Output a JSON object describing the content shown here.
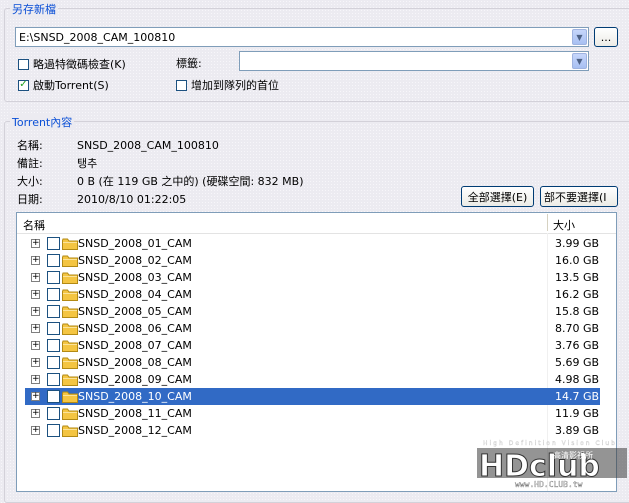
{
  "save_section": {
    "title": "另存新檔",
    "path_value": "E:\\SNSD_2008_CAM_100810",
    "browse_label": "...",
    "skip_hash_label": "略過特徵碼檢查(K)",
    "skip_hash_checked": false,
    "start_torrent_label": "啟動Torrent(S)",
    "start_torrent_checked": true,
    "label_caption": "標籤:",
    "label_value": "",
    "queue_top_label": "增加到隊列的首位",
    "queue_top_checked": false
  },
  "torrent_section": {
    "title": "Torrent內容",
    "name_label": "名稱:",
    "name_value": "SNSD_2008_CAM_100810",
    "comment_label": "備註:",
    "comment_value": "탱추",
    "size_label": "大小:",
    "size_value": "0 B (在 119 GB 之中的) (硬碟空間: 832 MB)",
    "date_label": "日期:",
    "date_value": "2010/8/10 01:22:05",
    "select_all_label": "全部選擇(E)",
    "deselect_all_label": "部不要選擇(I"
  },
  "file_tree": {
    "col_name": "名稱",
    "col_size": "大小",
    "selected_index": 9,
    "rows": [
      {
        "name": "SNSD_2008_01_CAM",
        "size": "3.99 GB"
      },
      {
        "name": "SNSD_2008_02_CAM",
        "size": "16.0 GB"
      },
      {
        "name": "SNSD_2008_03_CAM",
        "size": "13.5 GB"
      },
      {
        "name": "SNSD_2008_04_CAM",
        "size": "16.2 GB"
      },
      {
        "name": "SNSD_2008_05_CAM",
        "size": "15.8 GB"
      },
      {
        "name": "SNSD_2008_06_CAM",
        "size": "8.70 GB"
      },
      {
        "name": "SNSD_2008_07_CAM",
        "size": "3.76 GB"
      },
      {
        "name": "SNSD_2008_08_CAM",
        "size": "5.69 GB"
      },
      {
        "name": "SNSD_2008_09_CAM",
        "size": "4.98 GB"
      },
      {
        "name": "SNSD_2008_10_CAM",
        "size": "14.7 GB"
      },
      {
        "name": "SNSD_2008_11_CAM",
        "size": "11.9 GB"
      },
      {
        "name": "SNSD_2008_12_CAM",
        "size": "3.89 GB"
      }
    ]
  },
  "watermark": {
    "tagline": "High Definition Vision Club",
    "logo": "HDclub",
    "cn_name": "高清影視所",
    "url": "www.HD.CLUB.tw"
  },
  "colors": {
    "section_title": "#0a4fd6",
    "selection": "#316ac5",
    "checkmark": "#21a121",
    "folder": "#f4c542"
  }
}
